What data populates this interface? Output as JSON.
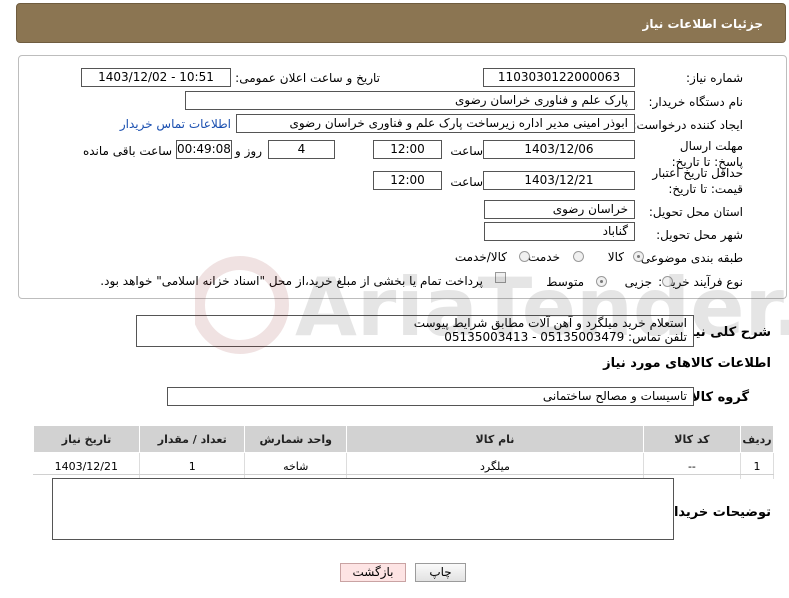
{
  "header": {
    "title": "جزئیات اطلاعات نیاز"
  },
  "form": {
    "need_number_label": "شماره نیاز:",
    "need_number": "1103030122000063",
    "announce_label": "تاریخ و ساعت اعلان عمومی:",
    "announce_value": "1403/12/02 - 10:51",
    "buyer_org_label": "نام دستگاه خریدار:",
    "buyer_org": "پارک علم و فناوری خراسان رضوی",
    "creator_label": "ایجاد کننده درخواست:",
    "creator": "ابوذر امینی مدیر اداره زیرساخت پارک علم و فناوری خراسان رضوی",
    "contact_link": "اطلاعات تماس خریدار",
    "reply_deadline_label": "مهلت ارسال پاسخ: تا تاریخ:",
    "reply_date": "1403/12/06",
    "time_label": "ساعت",
    "reply_time": "12:00",
    "days_value": "4",
    "days_label": "روز و",
    "remaining_time": "00:49:08",
    "remaining_label": "ساعت باقی مانده",
    "price_validity_label": "حداقل تاریخ اعتبار قیمت: تا تاریخ:",
    "price_date": "1403/12/21",
    "price_time": "12:00",
    "province_label": "استان محل تحویل:",
    "province": "خراسان رضوی",
    "city_label": "شهر محل تحویل:",
    "city": "گناباد",
    "category_label": "طبقه بندی موضوعی:",
    "category_options": [
      "کالا",
      "خدمت",
      "کالا/خدمت"
    ],
    "process_label": "نوع فرآیند خرید :",
    "process_options": [
      "جزیی",
      "متوسط"
    ],
    "payment_note": "پرداخت تمام یا بخشی از مبلغ خرید،از محل \"اسناد خزانه اسلامی\" خواهد بود."
  },
  "description": {
    "label": "شرح کلی نیاز:",
    "line1": "استعلام خرید میلگرد و آهن آلات مطابق شرایط پیوست",
    "line2": "تلفن تماس: 05135003479 - 05135003413"
  },
  "goods": {
    "section_title": "اطلاعات کالاهای مورد نیاز",
    "group_label": "گروه کالا:",
    "group_value": "تاسیسات و مصالح ساختمانی",
    "columns": [
      "ردیف",
      "کد کالا",
      "نام کالا",
      "واحد شمارش",
      "تعداد / مقدار",
      "تاریخ نیاز"
    ],
    "rows": [
      [
        "1",
        "--",
        "میلگرد",
        "شاخه",
        "1",
        "1403/12/21"
      ]
    ]
  },
  "buyer_notes": {
    "label": "توضیحات خریدار:"
  },
  "buttons": {
    "print": "چاپ",
    "back": "بازگشت"
  },
  "watermark": {
    "text": "AriaTender.net"
  }
}
